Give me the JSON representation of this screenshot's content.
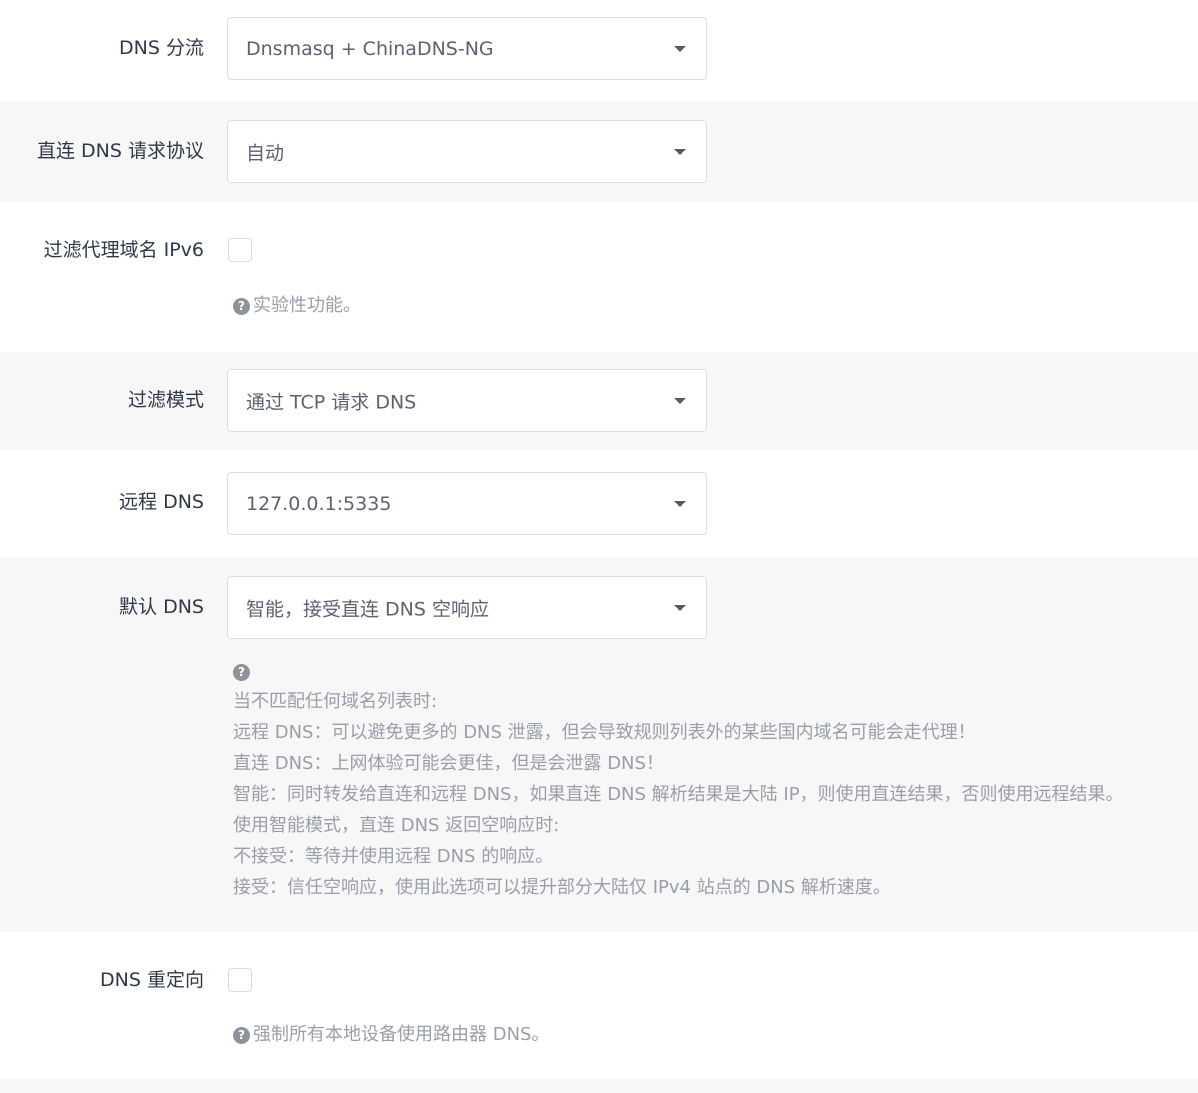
{
  "rows": [
    {
      "label": "DNS 分流",
      "value": "Dnsmasq + ChinaDNS-NG"
    },
    {
      "label": "直连 DNS 请求协议",
      "value": "自动"
    },
    {
      "label": "过滤代理域名 IPv6",
      "help": "实验性功能。"
    },
    {
      "label": "过滤模式",
      "value": "通过 TCP 请求 DNS"
    },
    {
      "label": "远程 DNS",
      "value": "127.0.0.1:5335"
    },
    {
      "label": "默认 DNS",
      "value": "智能，接受直连 DNS 空响应",
      "help_lines": [
        "当不匹配任何域名列表时:",
        "远程 DNS：可以避免更多的 DNS 泄露，但会导致规则列表外的某些国内域名可能会走代理！",
        "直连 DNS：上网体验可能会更佳，但是会泄露 DNS！",
        "智能：同时转发给直连和远程 DNS，如果直连 DNS 解析结果是大陆 IP，则使用直连结果，否则使用远程结果。",
        "使用智能模式，直连 DNS 返回空响应时:",
        "不接受：等待并使用远程 DNS 的响应。",
        "接受：信任空响应，使用此选项可以提升部分大陆仅 IPv4 站点的 DNS 解析速度。"
      ]
    },
    {
      "label": "DNS 重定向",
      "help": "强制所有本地设备使用路由器 DNS。"
    }
  ],
  "icons": {
    "help": "question-circle-icon",
    "dropdown": "caret-down-icon"
  }
}
